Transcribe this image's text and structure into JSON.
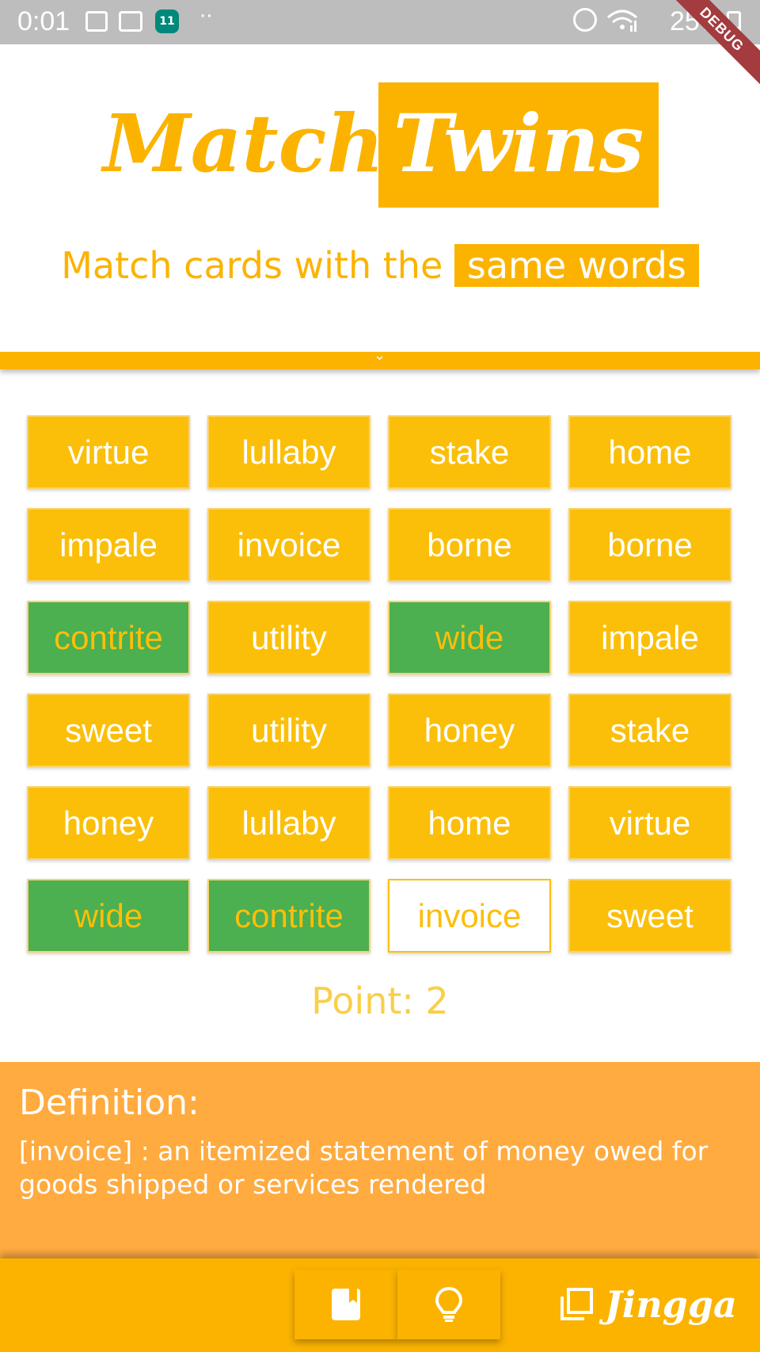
{
  "status_bar": {
    "time": "0:01",
    "calendar_day": "11",
    "dots": "··",
    "battery": "25%"
  },
  "debug_banner": "DEBUG",
  "header": {
    "logo_part1": "Match",
    "logo_part2": "Twins",
    "subtitle_prefix": "Match cards with the",
    "subtitle_highlight": "same words"
  },
  "cards": [
    {
      "word": "virtue",
      "state": "normal"
    },
    {
      "word": "lullaby",
      "state": "normal"
    },
    {
      "word": "stake",
      "state": "normal"
    },
    {
      "word": "home",
      "state": "normal"
    },
    {
      "word": "impale",
      "state": "normal"
    },
    {
      "word": "invoice",
      "state": "normal"
    },
    {
      "word": "borne",
      "state": "normal"
    },
    {
      "word": "borne",
      "state": "normal"
    },
    {
      "word": "contrite",
      "state": "matched"
    },
    {
      "word": "utility",
      "state": "normal"
    },
    {
      "word": "wide",
      "state": "matched"
    },
    {
      "word": "impale",
      "state": "normal"
    },
    {
      "word": "sweet",
      "state": "normal"
    },
    {
      "word": "utility",
      "state": "normal"
    },
    {
      "word": "honey",
      "state": "normal"
    },
    {
      "word": "stake",
      "state": "normal"
    },
    {
      "word": "honey",
      "state": "normal"
    },
    {
      "word": "lullaby",
      "state": "normal"
    },
    {
      "word": "home",
      "state": "normal"
    },
    {
      "word": "virtue",
      "state": "normal"
    },
    {
      "word": "wide",
      "state": "matched"
    },
    {
      "word": "contrite",
      "state": "matched"
    },
    {
      "word": "invoice",
      "state": "selected"
    },
    {
      "word": "sweet",
      "state": "normal"
    }
  ],
  "score": {
    "label": "Point: 2"
  },
  "definition": {
    "title": "Definition:",
    "text": "[invoice] : an itemized statement of money owed for goods shipped or services rendered"
  },
  "bottom_bar": {
    "buttons": [
      {
        "icon": "book-icon"
      },
      {
        "icon": "lightbulb-icon"
      }
    ],
    "brand": "Jingga"
  },
  "colors": {
    "primary": "#fbb300",
    "card": "#fbbf0a",
    "matched": "#4caf50",
    "definition_bg": "#ffab40"
  }
}
